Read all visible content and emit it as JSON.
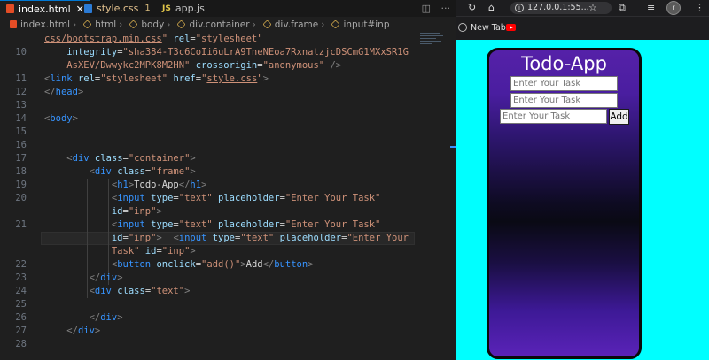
{
  "editor": {
    "tabs": [
      {
        "label": "index.html",
        "close": "✕"
      },
      {
        "label": "style.css",
        "badge": "1"
      },
      {
        "label": "app.js",
        "icon": "JS"
      }
    ],
    "actions": {
      "split": "◫",
      "more": "···"
    },
    "breadcrumb": [
      "index.html",
      "html",
      "body",
      "div.container",
      "div.frame",
      "input#inp"
    ],
    "lines": [
      {
        "n": "",
        "html": "<span class='s u'>css/bootstrap.min.css</span><span class='s'>\"</span> <span class='a'>rel</span><span class='w'>=</span><span class='s'>\"stylesheet\"</span>"
      },
      {
        "n": "10",
        "html": "    <span class='a'>integrity</span><span class='w'>=</span><span class='s'>\"sha384-T3c6CoIi6uLrA9TneNEoa7RxnatzjcDSCmG1MXxSR1G</span>"
      },
      {
        "n": "",
        "html": "    <span class='s'>AsXEV/Dwwykc2MPK8M2HN\"</span> <span class='a'>crossorigin</span><span class='w'>=</span><span class='s'>\"anonymous\"</span> <span class='p'>/&gt;</span>"
      },
      {
        "n": "11",
        "html": "<span class='p'>&lt;</span><span class='t'>link</span> <span class='a'>rel</span><span class='w'>=</span><span class='s'>\"stylesheet\"</span> <span class='a'>href</span><span class='w'>=</span><span class='s'>\"</span><span class='s u'>style.css</span><span class='s'>\"</span><span class='p'>&gt;</span>"
      },
      {
        "n": "12",
        "html": "<span class='p'>&lt;/</span><span class='t'>head</span><span class='p'>&gt;</span>"
      },
      {
        "n": "13",
        "html": ""
      },
      {
        "n": "14",
        "html": "<span class='p'>&lt;</span><span class='t'>body</span><span class='p'>&gt;</span>"
      },
      {
        "n": "15",
        "html": ""
      },
      {
        "n": "16",
        "html": ""
      },
      {
        "n": "17",
        "html": "    <span class='p'>&lt;</span><span class='t'>div</span> <span class='a'>class</span><span class='w'>=</span><span class='s'>\"container\"</span><span class='p'>&gt;</span>"
      },
      {
        "n": "18",
        "html": "        <span class='p'>&lt;</span><span class='t'>div</span> <span class='a'>class</span><span class='w'>=</span><span class='s'>\"frame\"</span><span class='p'>&gt;</span>"
      },
      {
        "n": "19",
        "html": "            <span class='p'>&lt;</span><span class='t'>h1</span><span class='p'>&gt;</span><span class='w'>Todo-App</span><span class='p'>&lt;/</span><span class='t'>h1</span><span class='p'>&gt;</span>"
      },
      {
        "n": "20",
        "html": "            <span class='p'>&lt;</span><span class='t'>input</span> <span class='a'>type</span><span class='w'>=</span><span class='s'>\"text\"</span> <span class='a'>placeholder</span><span class='w'>=</span><span class='s'>\"Enter Your Task\"</span>"
      },
      {
        "n": "",
        "html": "            <span class='a'>id</span><span class='w'>=</span><span class='s'>\"inp\"</span><span class='p'>&gt;</span>"
      },
      {
        "n": "21",
        "html": "            <span class='p'>&lt;</span><span class='t'>input</span> <span class='a'>type</span><span class='w'>=</span><span class='s'>\"text\"</span> <span class='a'>placeholder</span><span class='w'>=</span><span class='s'>\"Enter Your Task\"</span>"
      },
      {
        "n": "",
        "html": "            <span class='a'>id</span><span class='w'>=</span><span class='s'>\"inp\"</span><span class='p'>&gt;</span>  <span class='p'>&lt;</span><span class='t'>input</span> <span class='a'>type</span><span class='w'>=</span><span class='s'>\"text\"</span> <span class='a'>placeholder</span><span class='w'>=</span><span class='s'>\"Enter Your</span>"
      },
      {
        "n": "",
        "html": "            <span class='s'>Task\"</span> <span class='a'>id</span><span class='w'>=</span><span class='s'>\"inp\"</span><span class='p'>&gt;</span>"
      },
      {
        "n": "22",
        "html": "            <span class='p'>&lt;</span><span class='t'>button</span> <span class='a'>onclick</span><span class='w'>=</span><span class='s'>\"add()\"</span><span class='p'>&gt;</span><span class='w'>Add</span><span class='p'>&lt;/</span><span class='t'>button</span><span class='p'>&gt;</span>"
      },
      {
        "n": "23",
        "html": "        <span class='p'>&lt;/</span><span class='t'>div</span><span class='p'>&gt;</span>"
      },
      {
        "n": "24",
        "html": "        <span class='p'>&lt;</span><span class='t'>div</span> <span class='a'>class</span><span class='w'>=</span><span class='s'>\"text\"</span><span class='p'>&gt;</span>"
      },
      {
        "n": "25",
        "html": ""
      },
      {
        "n": "26",
        "html": "        <span class='p'>&lt;/</span><span class='t'>div</span><span class='p'>&gt;</span>"
      },
      {
        "n": "27",
        "html": "    <span class='p'>&lt;/</span><span class='t'>div</span><span class='p'>&gt;</span>"
      },
      {
        "n": "28",
        "html": ""
      }
    ]
  },
  "browser": {
    "url": "127.0.0.1:55...",
    "avatar": "r",
    "bookmarks": [
      {
        "label": "New Tab"
      }
    ],
    "page": {
      "title": "Todo-App",
      "placeholder": "Enter Your Task",
      "add_label": "Add"
    }
  },
  "colors": {
    "accent": "#0078d4",
    "page_bg": "#00ffff",
    "frame_top": "#5521a8",
    "frame_mid": "#0a0a14"
  }
}
